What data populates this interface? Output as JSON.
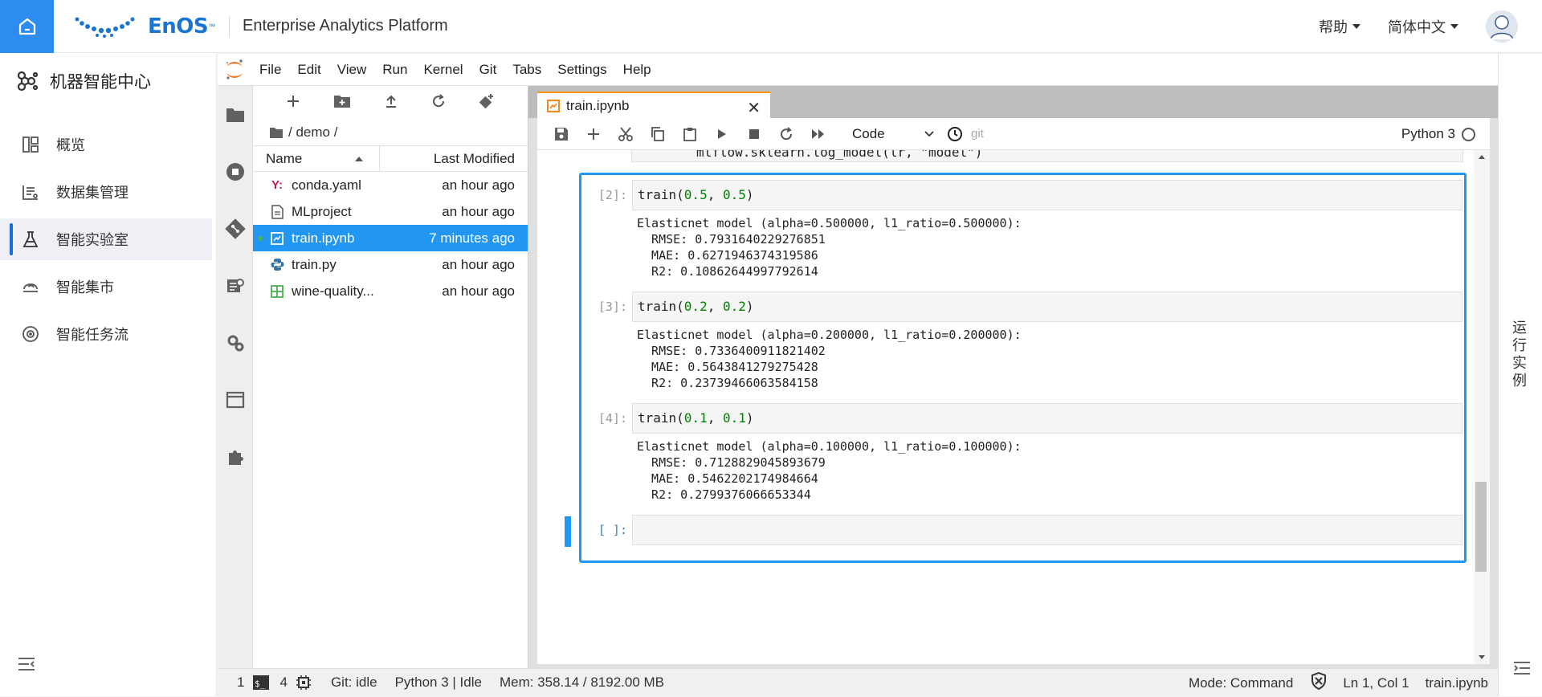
{
  "header": {
    "logo_text": "EnOS",
    "logo_tm": "™",
    "app_title": "Enterprise Analytics Platform",
    "help_label": "帮助",
    "language_label": "简体中文"
  },
  "leftnav": {
    "title": "机器智能中心",
    "items": [
      {
        "label": "概览",
        "icon": "dashboard-icon"
      },
      {
        "label": "数据集管理",
        "icon": "dataset-icon"
      },
      {
        "label": "智能实验室",
        "icon": "flask-icon"
      },
      {
        "label": "智能集市",
        "icon": "market-icon"
      },
      {
        "label": "智能任务流",
        "icon": "workflow-icon"
      }
    ],
    "active_index": 2
  },
  "jupyter": {
    "menu": [
      "File",
      "Edit",
      "View",
      "Run",
      "Kernel",
      "Git",
      "Tabs",
      "Settings",
      "Help"
    ],
    "breadcrumb": "/ demo /",
    "file_browser": {
      "col_name": "Name",
      "col_modified": "Last Modified",
      "files": [
        {
          "name": "conda.yaml",
          "modified": "an hour ago",
          "icon": "yaml-icon"
        },
        {
          "name": "MLproject",
          "modified": "an hour ago",
          "icon": "file-icon"
        },
        {
          "name": "train.ipynb",
          "modified": "7 minutes ago",
          "icon": "notebook-icon",
          "selected": true
        },
        {
          "name": "train.py",
          "modified": "an hour ago",
          "icon": "python-icon"
        },
        {
          "name": "wine-quality...",
          "modified": "an hour ago",
          "icon": "spreadsheet-icon"
        }
      ]
    },
    "notebook": {
      "tab_title": "train.ipynb",
      "cell_type": "Code",
      "git_label": "git",
      "kernel": "Python 3",
      "prev_code_tail": "mlflow.sklearn.log_model(lr, \"model\")",
      "cells": [
        {
          "prompt": "[2]:",
          "fn": "train(",
          "a": "0.5",
          "b": "0.5",
          "output": "Elasticnet model (alpha=0.500000, l1_ratio=0.500000):\n  RMSE: 0.7931640229276851\n  MAE: 0.6271946374319586\n  R2: 0.10862644997792614"
        },
        {
          "prompt": "[3]:",
          "fn": "train(",
          "a": "0.2",
          "b": "0.2",
          "output": "Elasticnet model (alpha=0.200000, l1_ratio=0.200000):\n  RMSE: 0.7336400911821402\n  MAE: 0.5643841279275428\n  R2: 0.23739466063584158"
        },
        {
          "prompt": "[4]:",
          "fn": "train(",
          "a": "0.1",
          "b": "0.1",
          "output": "Elasticnet model (alpha=0.100000, l1_ratio=0.100000):\n  RMSE: 0.7128829045893679\n  MAE: 0.5462202174984664\n  R2: 0.2799376066653344"
        }
      ],
      "empty_prompt": "[ ]:"
    },
    "status": {
      "terminals": "1",
      "kernels": "4",
      "git": "Git: idle",
      "kernel_status": "Python 3 | Idle",
      "memory": "Mem: 358.14 / 8192.00 MB",
      "mode": "Mode: Command",
      "cursor": "Ln 1, Col 1",
      "file": "train.ipynb"
    }
  },
  "right_panel": {
    "label": "运行实例"
  },
  "colors": {
    "accent": "#2196f3",
    "home": "#2d8cf0",
    "brand": "#1a75d2",
    "jupyter_orange": "#ff9800"
  }
}
